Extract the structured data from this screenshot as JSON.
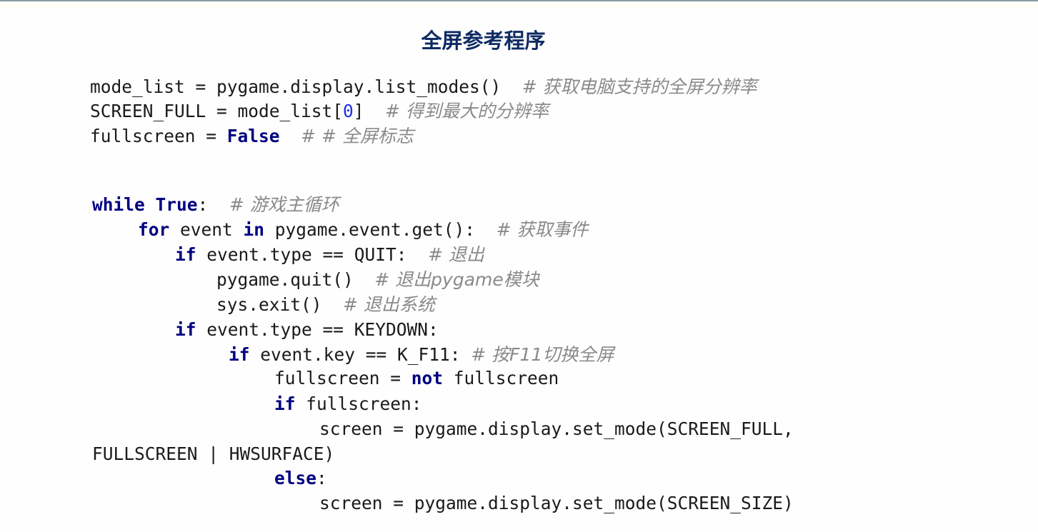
{
  "slide": {
    "title": "全屏参考程序"
  },
  "colors": {
    "title": "#0f2b63",
    "keyword": "#000080",
    "number": "#1c2fe6",
    "comment": "#8a8a8a",
    "code_text": "#1a1a1a"
  },
  "code": {
    "lines": [
      {
        "tokens": [
          {
            "t": "text",
            "v": "mode_list = pygame.display.list_modes()  "
          },
          {
            "t": "cm",
            "v": "# 获取电脑支持的全屏分辨率"
          }
        ]
      },
      {
        "tokens": [
          {
            "t": "text",
            "v": "SCREEN_FULL = mode_list["
          },
          {
            "t": "num",
            "v": "0"
          },
          {
            "t": "text",
            "v": "]  "
          },
          {
            "t": "cm",
            "v": "# 得到最大的分辨率"
          }
        ]
      },
      {
        "tokens": [
          {
            "t": "text",
            "v": "fullscreen = "
          },
          {
            "t": "kw",
            "v": "False"
          },
          {
            "t": "text",
            "v": "  "
          },
          {
            "t": "cm",
            "v": "# # 全屏标志"
          }
        ]
      },
      {
        "tokens": [
          {
            "t": "kw",
            "v": "while"
          },
          {
            "t": "text",
            "v": " "
          },
          {
            "t": "kw",
            "v": "True"
          },
          {
            "t": "text",
            "v": ":  "
          },
          {
            "t": "cm",
            "v": "# 游戏主循环"
          }
        ]
      },
      {
        "tokens": [
          {
            "t": "kw",
            "v": "for"
          },
          {
            "t": "text",
            "v": " event "
          },
          {
            "t": "kw",
            "v": "in"
          },
          {
            "t": "text",
            "v": " pygame.event.get():  "
          },
          {
            "t": "cm",
            "v": "# 获取事件"
          }
        ]
      },
      {
        "tokens": [
          {
            "t": "kw",
            "v": "if"
          },
          {
            "t": "text",
            "v": " event.type == QUIT:  "
          },
          {
            "t": "cm",
            "v": "# 退出"
          }
        ]
      },
      {
        "tokens": [
          {
            "t": "text",
            "v": "pygame.quit()  "
          },
          {
            "t": "cm",
            "v": "# 退出pygame模块"
          }
        ]
      },
      {
        "tokens": [
          {
            "t": "text",
            "v": "sys.exit()  "
          },
          {
            "t": "cm",
            "v": "# 退出系统"
          }
        ]
      },
      {
        "tokens": [
          {
            "t": "kw",
            "v": "if"
          },
          {
            "t": "text",
            "v": " event.type == KEYDOWN:"
          }
        ]
      },
      {
        "tokens": [
          {
            "t": "kw",
            "v": "if"
          },
          {
            "t": "text",
            "v": " event.key == K_F11: "
          },
          {
            "t": "cm",
            "v": "# 按F11切换全屏"
          }
        ]
      },
      {
        "tokens": [
          {
            "t": "text",
            "v": "fullscreen = "
          },
          {
            "t": "kw",
            "v": "not"
          },
          {
            "t": "text",
            "v": " fullscreen"
          }
        ]
      },
      {
        "tokens": [
          {
            "t": "kw",
            "v": "if"
          },
          {
            "t": "text",
            "v": " fullscreen:"
          }
        ]
      },
      {
        "tokens": [
          {
            "t": "text",
            "v": "screen = pygame.display.set_mode(SCREEN_FULL,"
          }
        ]
      },
      {
        "tokens": [
          {
            "t": "text",
            "v": "FULLSCREEN | HWSURFACE)"
          }
        ]
      },
      {
        "tokens": [
          {
            "t": "kw",
            "v": "else"
          },
          {
            "t": "text",
            "v": ":"
          }
        ]
      },
      {
        "tokens": [
          {
            "t": "text",
            "v": "screen = pygame.display.set_mode(SCREEN_SIZE)"
          }
        ]
      }
    ]
  }
}
